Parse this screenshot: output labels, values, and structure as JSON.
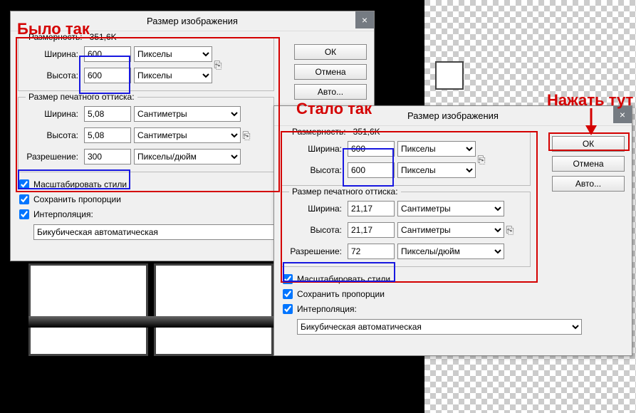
{
  "annotations": {
    "was": "Было так",
    "became": "Стало так",
    "press_here": "Нажать тут"
  },
  "dialog1": {
    "title": "Размер изображения",
    "close": "×",
    "dims_label": "Размерность:",
    "dims_value": "351,6K",
    "width_label": "Ширина:",
    "width_value": "600",
    "height_label": "Высота:",
    "height_value": "600",
    "unit_px": "Пикселы",
    "print_legend": "Размер печатного оттиска:",
    "print_width_label": "Ширина:",
    "print_width_value": "5,08",
    "print_height_label": "Высота:",
    "print_height_value": "5,08",
    "unit_cm": "Сантиметры",
    "res_label": "Разрешение:",
    "res_value": "300",
    "unit_ppi": "Пикселы/дюйм",
    "chk_scale": "Масштабировать стили",
    "chk_aspect": "Сохранить пропорции",
    "chk_interp": "Интерполяция:",
    "interp_method": "Бикубическая автоматическая",
    "btn_ok": "ОК",
    "btn_cancel": "Отмена",
    "btn_auto": "Авто..."
  },
  "dialog2": {
    "title": "Размер изображения",
    "close": "×",
    "dims_label": "Размерность:",
    "dims_value": "351,6K",
    "width_label": "Ширина:",
    "width_value": "600",
    "height_label": "Высота:",
    "height_value": "600",
    "unit_px": "Пикселы",
    "print_legend": "Размер печатного оттиска:",
    "print_width_label": "Ширина:",
    "print_width_value": "21,17",
    "print_height_label": "Высота:",
    "print_height_value": "21,17",
    "unit_cm": "Сантиметры",
    "res_label": "Разрешение:",
    "res_value": "72",
    "unit_ppi": "Пикселы/дюйм",
    "chk_scale": "Масштабировать стили",
    "chk_aspect": "Сохранить пропорции",
    "chk_interp": "Интерполяция:",
    "interp_method": "Бикубическая автоматическая",
    "btn_ok": "ОК",
    "btn_cancel": "Отмена",
    "btn_auto": "Авто..."
  }
}
